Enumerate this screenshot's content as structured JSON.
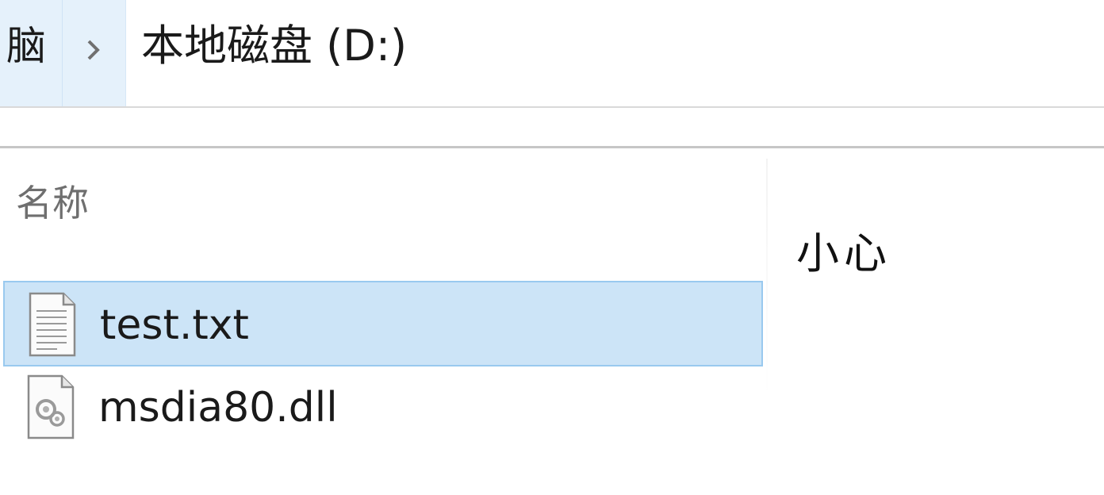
{
  "address_bar": {
    "prev_crumb": "脑",
    "current_crumb": "本地磁盘 (D:)"
  },
  "column_headers": {
    "name": "名称"
  },
  "side_label": "小心",
  "files": [
    {
      "name": "test.txt",
      "icon": "text-file-icon",
      "selected": true
    },
    {
      "name": "msdia80.dll",
      "icon": "dll-file-icon",
      "selected": false
    }
  ],
  "colors": {
    "selection_bg": "#cce4f7",
    "selection_border": "#99c9ef",
    "breadcrumb_bg": "#e5f1fb"
  }
}
